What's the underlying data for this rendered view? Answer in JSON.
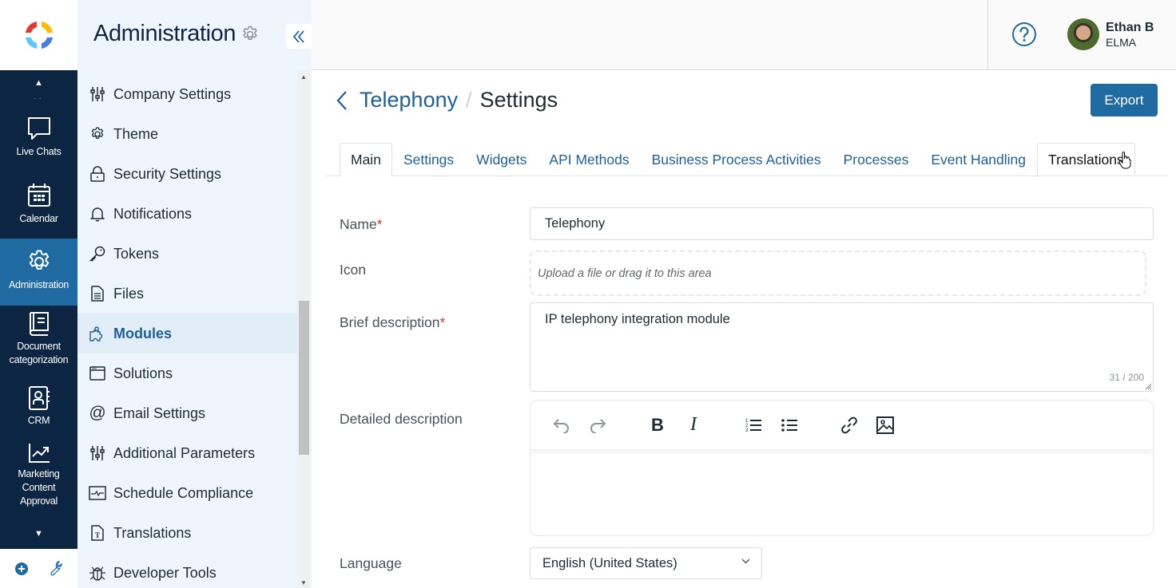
{
  "app": {
    "logo": "elma-logo",
    "colors": {
      "nav_bg": "#0b2542",
      "nav_active": "#1f6aa1",
      "sidebar_bg": "#eff5fc",
      "accent": "#1f5f95",
      "required": "#d93636",
      "button": "#1f6aa1"
    }
  },
  "nav": {
    "items": [
      {
        "label": "Live Chats",
        "icon": "chat-bubble-icon"
      },
      {
        "label": "Calendar",
        "icon": "calendar-icon"
      },
      {
        "label": "Administration",
        "icon": "gear-icon",
        "active": true
      },
      {
        "label": "Document categorization",
        "icon": "book-icon"
      },
      {
        "label": "CRM",
        "icon": "contact-book-icon"
      },
      {
        "label": "Marketing Content Approval",
        "icon": "chart-trend-icon"
      }
    ],
    "bottom": [
      {
        "icon": "add-circle-icon"
      },
      {
        "icon": "wrench-icon"
      }
    ]
  },
  "sidebar": {
    "title": "Administration",
    "items": [
      {
        "label": "Company Settings",
        "icon": "sliders-icon"
      },
      {
        "label": "Theme",
        "icon": "gear-icon"
      },
      {
        "label": "Security Settings",
        "icon": "lock-icon"
      },
      {
        "label": "Notifications",
        "icon": "bell-icon"
      },
      {
        "label": "Tokens",
        "icon": "key-icon"
      },
      {
        "label": "Files",
        "icon": "file-icon"
      },
      {
        "label": "Modules",
        "icon": "puzzle-icon",
        "active": true
      },
      {
        "label": "Solutions",
        "icon": "window-icon"
      },
      {
        "label": "Email Settings",
        "icon": "at-sign-icon"
      },
      {
        "label": "Additional Parameters",
        "icon": "sliders-icon"
      },
      {
        "label": "Schedule Compliance",
        "icon": "pulse-icon"
      },
      {
        "label": "Translations",
        "icon": "text-file-icon"
      },
      {
        "label": "Developer Tools",
        "icon": "bug-icon"
      }
    ]
  },
  "topbar": {
    "user": {
      "name": "Ethan B",
      "org": "ELMA"
    }
  },
  "page": {
    "breadcrumb": {
      "parent": "Telephony",
      "separator": "/",
      "current": "Settings"
    },
    "export_label": "Export",
    "tabs": [
      {
        "label": "Main",
        "active": true
      },
      {
        "label": "Settings"
      },
      {
        "label": "Widgets"
      },
      {
        "label": "API Methods"
      },
      {
        "label": "Business Process Activities"
      },
      {
        "label": "Processes"
      },
      {
        "label": "Event Handling"
      },
      {
        "label": "Translations",
        "hover": true
      }
    ],
    "form": {
      "name_label": "Name",
      "name_value": "Telephony",
      "icon_label": "Icon",
      "upload_placeholder": "Upload a file or drag it to this area",
      "brief_label": "Brief description",
      "brief_value": "IP telephony integration module",
      "brief_counter": "31 / 200",
      "detailed_label": "Detailed description",
      "language_label": "Language",
      "language_value": "English (United States)",
      "required_mark": "*"
    }
  }
}
